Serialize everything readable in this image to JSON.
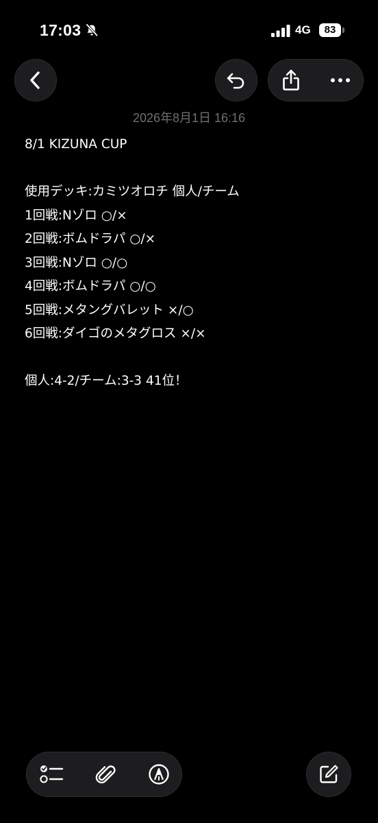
{
  "status_bar": {
    "time": "17:03",
    "network": "4G",
    "battery": "83",
    "icons": [
      "bell-slash-icon",
      "signal-bars-icon"
    ]
  },
  "toolbar": {
    "icons": [
      "chevron-left-icon",
      "undo-icon",
      "share-icon",
      "ellipsis-icon"
    ]
  },
  "note": {
    "date": "2026年8月1日 16:16",
    "lines": [
      "8/1 KIZUNA CUP",
      "",
      "使用デッキ:カミツオロチ 個人/チーム",
      "1回戦:Nゾロ ○/×",
      "2回戦:ボムドラパ ○/×",
      "3回戦:Nゾロ ○/○",
      "4回戦:ボムドラパ ○/○",
      "5回戦:メタングバレット ×/○",
      "6回戦:ダイゴのメタグロス ×/×",
      "",
      "個人:4-2/チーム:3-3 41位！"
    ]
  },
  "bottom_toolbar": {
    "icons": [
      "checklist-icon",
      "paperclip-icon",
      "markup-pen-icon",
      "compose-icon"
    ]
  },
  "colors": {
    "background": "#000000",
    "button_bg": "#1d1d1f",
    "date_text": "#6f6f73",
    "text": "#ffffff"
  }
}
